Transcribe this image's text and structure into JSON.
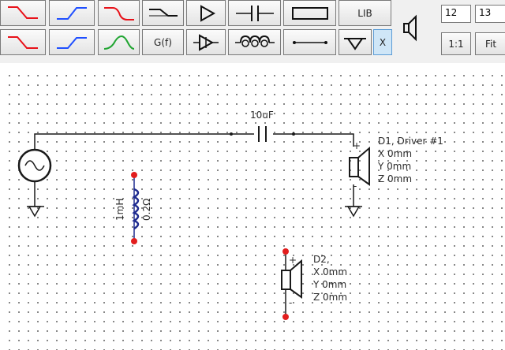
{
  "toolbar": {
    "row1": [
      {
        "name": "highpass-red-filter-button",
        "icon": "highpass-red-icon"
      },
      {
        "name": "lowpass-blue-filter-button",
        "icon": "lowpass-blue-icon"
      },
      {
        "name": "bandstop-red-filter-button",
        "icon": "notch-red-icon"
      },
      {
        "name": "shelf-filter-button",
        "icon": "shelf-black-icon"
      },
      {
        "name": "amplifier-button",
        "icon": "amplifier-icon"
      },
      {
        "name": "capacitor-button",
        "icon": "capacitor-icon"
      },
      {
        "name": "resistor-button",
        "icon": "resistor-icon"
      },
      {
        "name": "library-button",
        "label": "LIB"
      },
      {
        "name": "speaker-button",
        "icon": "speaker-icon"
      }
    ],
    "row2": [
      {
        "name": "highpass2-red-filter-button",
        "icon": "highpass-red-icon"
      },
      {
        "name": "lowpass2-blue-filter-button",
        "icon": "lowpass-blue-icon"
      },
      {
        "name": "bandpass-green-filter-button",
        "icon": "bandpass-green-icon"
      },
      {
        "name": "transfer-function-button",
        "label": "G(f)"
      },
      {
        "name": "buffer-amplifier-button",
        "icon": "buffer-icon"
      },
      {
        "name": "inductor-button",
        "icon": "inductor-icon"
      },
      {
        "name": "wire-button",
        "icon": "wire-icon"
      },
      {
        "name": "ground-button",
        "icon": "ground-icon"
      },
      {
        "name": "delete-button",
        "label": "X"
      }
    ],
    "field_a": "12",
    "field_b": "13",
    "zoom_1to1": "1:1",
    "zoom_fit": "Fit"
  },
  "schematic": {
    "capacitor_label": "10uF",
    "inductor_value": "1mH",
    "inductor_resistance": "0.2Ω",
    "driver1": {
      "name": "D1, Driver #1",
      "x": "X 0mm",
      "y": "Y 0mm",
      "z": "Z 0mm"
    },
    "driver2": {
      "name": "D2,",
      "x": "X 0mm",
      "y": "Y 0mm",
      "z": "Z 0mm"
    },
    "plus": "+",
    "minus": "-"
  },
  "colors": {
    "red": "#e8121a",
    "blue": "#1f4fff",
    "green": "#21a532",
    "wire": "#1a1a1a",
    "inductor": "#1d2a8f",
    "terminal": "#e21d1d",
    "pressed": "#cfe6f7"
  }
}
